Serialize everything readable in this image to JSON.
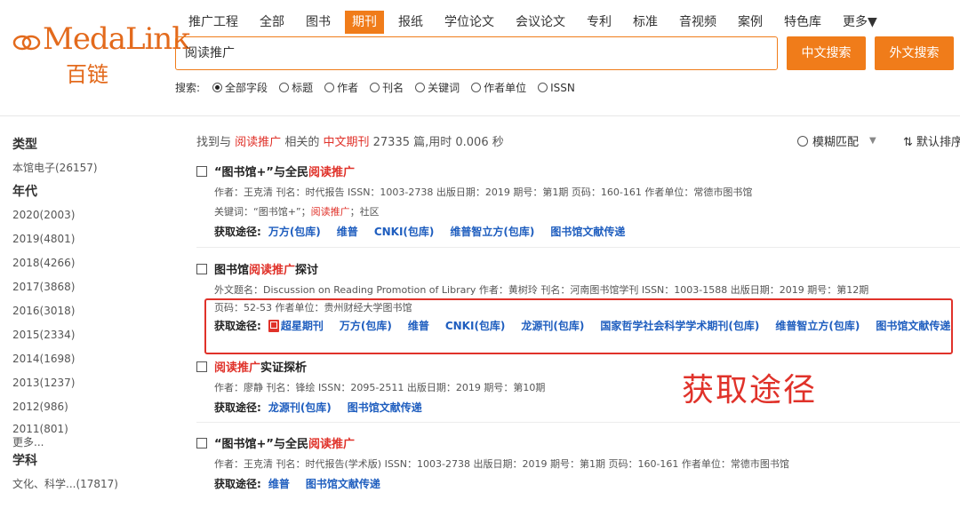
{
  "brand": {
    "name": "MedaLink",
    "cn_name": "百链",
    "accent": "#f07c1a",
    "highlight": "#e0322a",
    "link": "#1f5ebf"
  },
  "nav": {
    "tabs": [
      "推广工程",
      "全部",
      "图书",
      "期刊",
      "报纸",
      "学位论文",
      "会议论文",
      "专利",
      "标准",
      "音视频",
      "案例",
      "特色库",
      "更多▼"
    ],
    "active": "期刊"
  },
  "search": {
    "value": "阅读推广",
    "cn_button": "中文搜索",
    "foreign_button": "外文搜索",
    "scope_label": "搜索:",
    "options": [
      "全部字段",
      "标题",
      "作者",
      "刊名",
      "关键词",
      "作者单位",
      "ISSN"
    ],
    "selected": "全部字段"
  },
  "sidebar": {
    "type_heading": "类型",
    "type_items": [
      "本馆电子(26157)"
    ],
    "year_heading": "年代",
    "year_items": [
      "2020(2003)",
      "2019(4801)",
      "2018(4266)",
      "2017(3868)",
      "2016(3018)",
      "2015(2334)",
      "2014(1698)",
      "2013(1237)",
      "2012(986)",
      "2011(801)"
    ],
    "more": "更多...",
    "subject_heading": "学科",
    "subject_items": [
      "文化、科学...(17817)"
    ]
  },
  "summary": {
    "prefix": "找到与",
    "keyword": "阅读推广",
    "mid": "相关的",
    "category": "中文期刊",
    "suffix": "27335 篇,用时 0.006 秒",
    "fuzzy": "模糊匹配",
    "sort": "默认排序"
  },
  "results": [
    {
      "title_pre": "“图书馆+”与全民",
      "title_hl": "阅读推广",
      "title_post": "",
      "meta": "作者：王克清   刊名：时代报告   ISSN：1003-2738   出版日期：2019   期号：第1期   页码：160-161   作者单位：常德市图书馆",
      "meta2_pre": "关键词：“图书馆+”；",
      "meta2_hl": "阅读推广",
      "meta2_post": "；社区",
      "links_label": "获取途径:",
      "links": [
        "万方(包库)",
        "维普",
        "CNKI(包库)",
        "维普智立方(包库)",
        "图书馆文献传递"
      ]
    },
    {
      "title_pre": "图书馆",
      "title_hl": "阅读推广",
      "title_post": "探讨",
      "meta": "外文题名：Discussion on Reading Promotion of Library   作者：黄树玲   刊名：河南图书馆学刊   ISSN：1003-1588   出版日期：2019   期号：第12期",
      "meta2": "页码：52-53   作者单位：贵州财经大学图书馆",
      "links_label": "获取途径:",
      "pdf_link": "超星期刊",
      "links": [
        "万方(包库)",
        "维普",
        "CNKI(包库)",
        "龙源刊(包库)",
        "国家哲学社会科学学术期刊(包库)",
        "维普智立方(包库)",
        "图书馆文献传递"
      ]
    },
    {
      "title_pre": "",
      "title_hl": "阅读推广",
      "title_post": "实证探析",
      "meta": "作者：廖静   刊名：锋绘   ISSN：2095-2511   出版日期：2019   期号：第10期",
      "links_label": "获取途径:",
      "links": [
        "龙源刊(包库)",
        "图书馆文献传递"
      ]
    },
    {
      "title_pre": "“图书馆+”与全民",
      "title_hl": "阅读推广",
      "title_post": "",
      "meta": "作者：王克清   刊名：时代报告(学术版)   ISSN：1003-2738   出版日期：2019   期号：第1期   页码：160-161   作者单位：常德市图书馆",
      "links_label": "获取途径:",
      "links": [
        "维普",
        "图书馆文献传递"
      ]
    }
  ],
  "annotation": "获取途径"
}
